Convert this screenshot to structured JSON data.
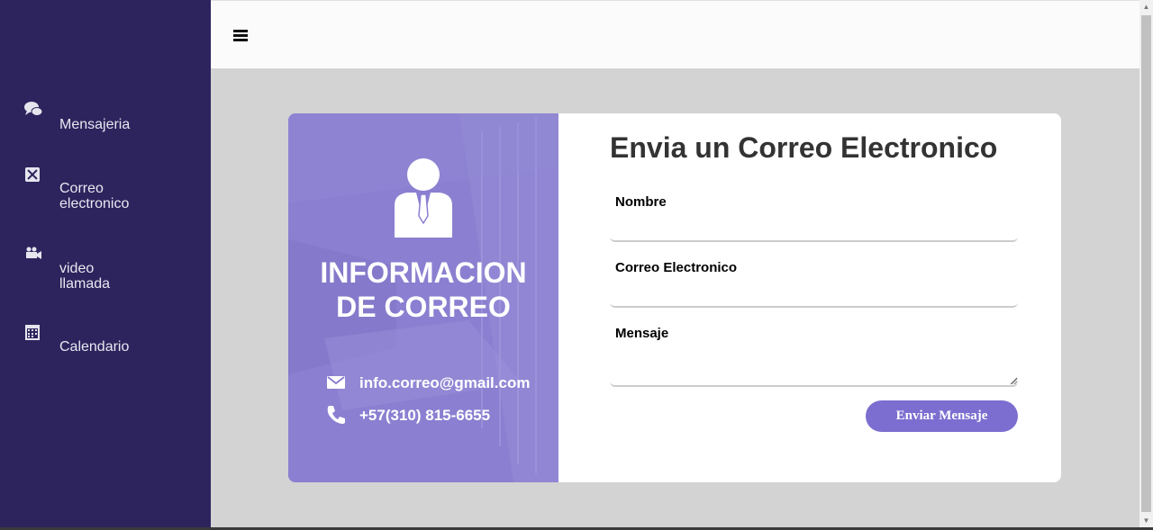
{
  "sidebar": {
    "items": [
      {
        "icon": "chat-bubbles-icon",
        "label": "Mensajeria",
        "lines": [
          "Mensajeria"
        ]
      },
      {
        "icon": "envelope-box-icon",
        "label": "Correo electronico",
        "lines": [
          "Correo",
          "electronico"
        ]
      },
      {
        "icon": "video-camera-icon",
        "label": "video llamada",
        "lines": [
          "video",
          "llamada"
        ]
      },
      {
        "icon": "calendar-icon",
        "label": "Calendario",
        "lines": [
          "Calendario"
        ]
      }
    ]
  },
  "topbar": {
    "menu_icon": "hamburger-icon"
  },
  "info": {
    "title_line1": "INFORMACION",
    "title_line2": "DE CORREO",
    "email": "info.correo@gmail.com",
    "phone": "+57(310) 815-6655"
  },
  "form": {
    "title": "Envia un Correo Electronico",
    "name_label": "Nombre",
    "email_label": "Correo Electronico",
    "message_label": "Mensaje",
    "name_value": "",
    "email_value": "",
    "message_value": "",
    "submit_label": "Enviar Mensaje"
  },
  "colors": {
    "sidebar_bg": "#2d245e",
    "panel_purple": "#8a7fd0",
    "button_purple": "#7b6ed0",
    "page_bg": "#d3d3d3"
  }
}
